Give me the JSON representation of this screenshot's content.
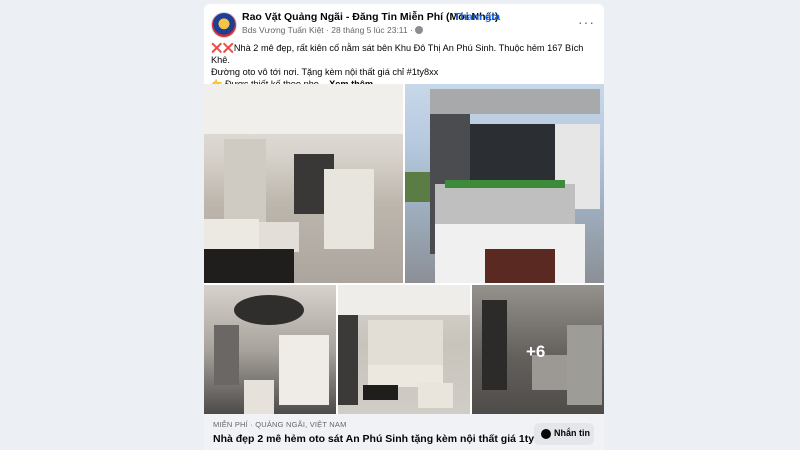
{
  "post": {
    "group_name": "Rao Vặt Quảng Ngãi - Đăng Tin Miễn Phí (Mới Nhất)",
    "separator": "·",
    "join_label": "Tham gia",
    "author_time": "Bds Vương Tuấn Kiệt · 28 tháng 5 lúc 23:11 ·",
    "more_label": "···",
    "text_line1": "Nhà 2 mê đẹp, rất kiên cố nằm sát bên Khu Đô Thị An Phú Sinh. Thuộc hẻm 167 Bích Khê.",
    "text_line2": "Đường oto vô tới nơi. Tặng kèm nội thất giá chỉ #1ty8xx",
    "text_line3": "Được thiết kế theo pho...",
    "see_more": "Xem thêm",
    "x_emoji": "❌❌",
    "hand_emoji": "👉"
  },
  "photos": {
    "extra_count": "+6"
  },
  "link": {
    "meta": "MIỄN PHÍ · QUẢNG NGÃI, VIỆT NAM",
    "title": "Nhà đẹp 2 mê hẻm oto sát An Phú Sinh tặng kèm nội thất giá 1ty8xx",
    "message_button": "Nhắn tin"
  }
}
